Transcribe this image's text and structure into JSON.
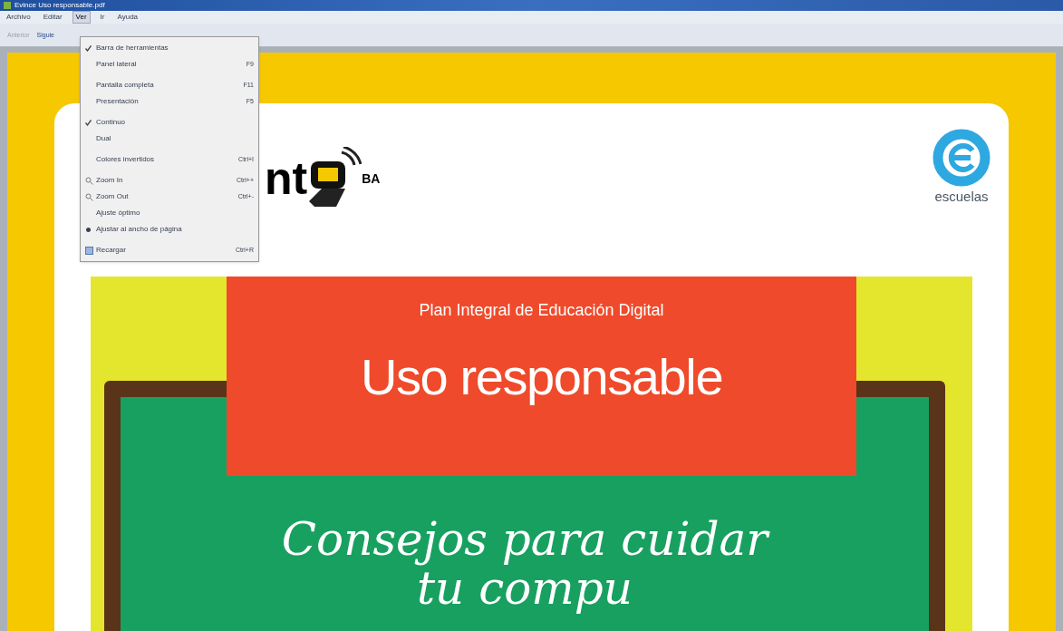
{
  "window": {
    "title": "Evince Uso responsable.pdf"
  },
  "menu_bar": [
    {
      "label": "Archivo",
      "selected": false
    },
    {
      "label": "Editar",
      "selected": false
    },
    {
      "label": "Ver",
      "selected": true
    },
    {
      "label": "Ir",
      "selected": false
    },
    {
      "label": "Ayuda",
      "selected": false
    }
  ],
  "toolbar": [
    {
      "label": "Anterior",
      "disabled": true
    },
    {
      "label": "Siguie",
      "disabled": false
    }
  ],
  "view_menu": [
    {
      "kind": "check",
      "label": "Barra de herramientas",
      "checked": true
    },
    {
      "kind": "check",
      "label": "Panel lateral",
      "shortcut": "F9",
      "checked": false
    },
    {
      "kind": "separator"
    },
    {
      "kind": "check",
      "label": "Pantalla completa",
      "shortcut": "F11",
      "checked": false
    },
    {
      "kind": "check",
      "label": "Presentación",
      "shortcut": "F5",
      "checked": false
    },
    {
      "kind": "separator"
    },
    {
      "kind": "check",
      "label": "Continuo",
      "checked": true
    },
    {
      "kind": "check",
      "label": "Dual",
      "checked": false
    },
    {
      "kind": "separator"
    },
    {
      "kind": "check",
      "label": "Colores invertidos",
      "shortcut": "Ctrl+I",
      "checked": false
    },
    {
      "kind": "separator"
    },
    {
      "kind": "zoom",
      "label": "Zoom In",
      "shortcut": "Ctrl++"
    },
    {
      "kind": "zoom",
      "label": "Zoom Out",
      "shortcut": "Ctrl+-"
    },
    {
      "kind": "radio",
      "label": "Ajuste óptimo",
      "selected": false
    },
    {
      "kind": "radio",
      "label": "Ajustar al ancho de página",
      "selected": true
    },
    {
      "kind": "separator"
    },
    {
      "kind": "reload",
      "label": "Recargar",
      "shortcut": "Ctrl+R"
    }
  ],
  "document": {
    "logo_left": {
      "text": "nt",
      "badge": "BA"
    },
    "logo_right": {
      "text": "escuelas"
    },
    "banner": {
      "subtitle": "Plan Integral de Educación Digital",
      "title": "Uso responsable"
    },
    "chalkboard": [
      "Consejos para cuidar",
      "tu compu"
    ]
  }
}
